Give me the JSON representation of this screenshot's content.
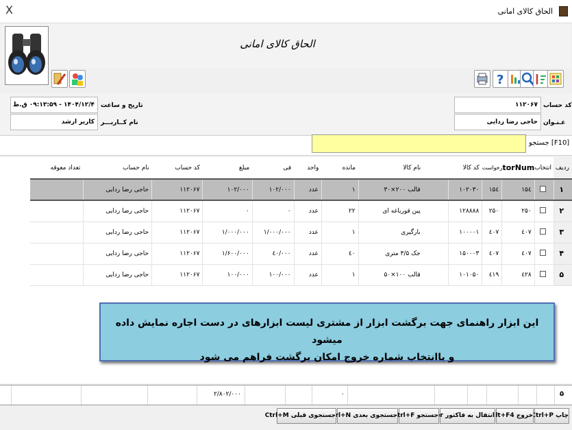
{
  "window": {
    "title": "الحاق کالای امانی",
    "close": "X"
  },
  "form_title": "الحاق کالای امانی",
  "info": {
    "date_label": "تاریخ و ساعت",
    "date_value": "۱۴۰۴/۱۲/۴ - ۰۹:۱۳:۵۹ ق.ظ",
    "user_label": "نام کــاربـــر",
    "user_value": "کاربر ارشد",
    "account_label": "کد حساب",
    "account_value": "۱۱۲۰۶۷",
    "name_label": "عـنـوان",
    "name_value": "حاجی رضا ردایی"
  },
  "search": {
    "label": "جستجو [F10]",
    "value": ""
  },
  "table": {
    "headers": {
      "rownum": "ردیف",
      "select": "انتخاب",
      "factor": "FactorNum",
      "request": "درخواست",
      "code": "کد کالا",
      "name": "نام کالا",
      "remaining": "مانده",
      "unit": "واحد",
      "fee": "فی",
      "amount": "مبلغ",
      "acc_code": "کد حساب",
      "acc_name": "نام حساب",
      "overdue": "تعداد معوقه"
    },
    "rows": [
      {
        "rownum": "۱",
        "factor": "۱۵٤",
        "request": "۱۵٤",
        "code": "۱۰۲۰۳۰",
        "name": "قالب ۲۰۰×۳۰",
        "remaining": "۱",
        "unit": "عدد",
        "fee": "۱۰۲/۰۰۰",
        "amount": "۱۰۲/۰۰۰",
        "acc_code": "۱۱۲۰۶۷",
        "acc_name": "حاجی رضا ردایی",
        "overdue": ""
      },
      {
        "rownum": "۲",
        "factor": "۲۵۰",
        "request": "۲۵۰",
        "code": "۱۲۸۸۸۸",
        "name": "پین قورباغه ای",
        "remaining": "۲۲",
        "unit": "عدد",
        "fee": "۰",
        "amount": "۰",
        "acc_code": "۱۱۲۰۶۷",
        "acc_name": "حاجی رضا ردایی",
        "overdue": ""
      },
      {
        "rownum": "۳",
        "factor": "٤۰۷",
        "request": "٤۰۷",
        "code": "۱۰۰۰۰۱",
        "name": "بارگیری",
        "remaining": "۱",
        "unit": "عدد",
        "fee": "۱/۰۰۰/۰۰۰",
        "amount": "۱/۰۰۰/۰۰۰",
        "acc_code": "۱۱۲۰۶۷",
        "acc_name": "حاجی رضا ردایی",
        "overdue": ""
      },
      {
        "rownum": "۴",
        "factor": "٤۰۷",
        "request": "٤۰۷",
        "code": "۱۵۰۰۰۳",
        "name": "جک ۳/۵ متری",
        "remaining": "٤۰",
        "unit": "عدد",
        "fee": "٤۰/۰۰۰",
        "amount": "۱/۶۰۰/۰۰۰",
        "acc_code": "۱۱۲۰۶۷",
        "acc_name": "حاجی رضا ردایی",
        "overdue": ""
      },
      {
        "rownum": "۵",
        "factor": "٤۲۸",
        "request": "٤۱۹",
        "code": "۱۰۱۰۵۰",
        "name": "قالب ۱۰۰×۵۰",
        "remaining": "۱",
        "unit": "عدد",
        "fee": "۱۰۰/۰۰۰",
        "amount": "۱۰۰/۰۰۰",
        "acc_code": "۱۱۲۰۶۷",
        "acc_name": "حاجی رضا ردایی",
        "overdue": ""
      }
    ]
  },
  "note": {
    "line1": "این ابزار راهنمای جهت برگشت ابزار از مشتری لیست ابزارهای در دست اجاره نمایش داده میشود",
    "line2": "و باانتخاب شماره خروج امکان برگشت فراهم می شود"
  },
  "footer": {
    "count": "۵",
    "remaining_total": "۰",
    "amount_total": "۲/۸۰۲/۰۰۰"
  },
  "buttons": {
    "print": "چاپ Ctrl+P",
    "exit": "خروج Alt+F4",
    "transfer": "انتقال به فاکتور Enter",
    "search": "جستجو Ctrl+F",
    "search_next": "جستجوی بعدی Ctrl+N",
    "search_prev": "جستجوی قبلی Ctrl+M"
  }
}
